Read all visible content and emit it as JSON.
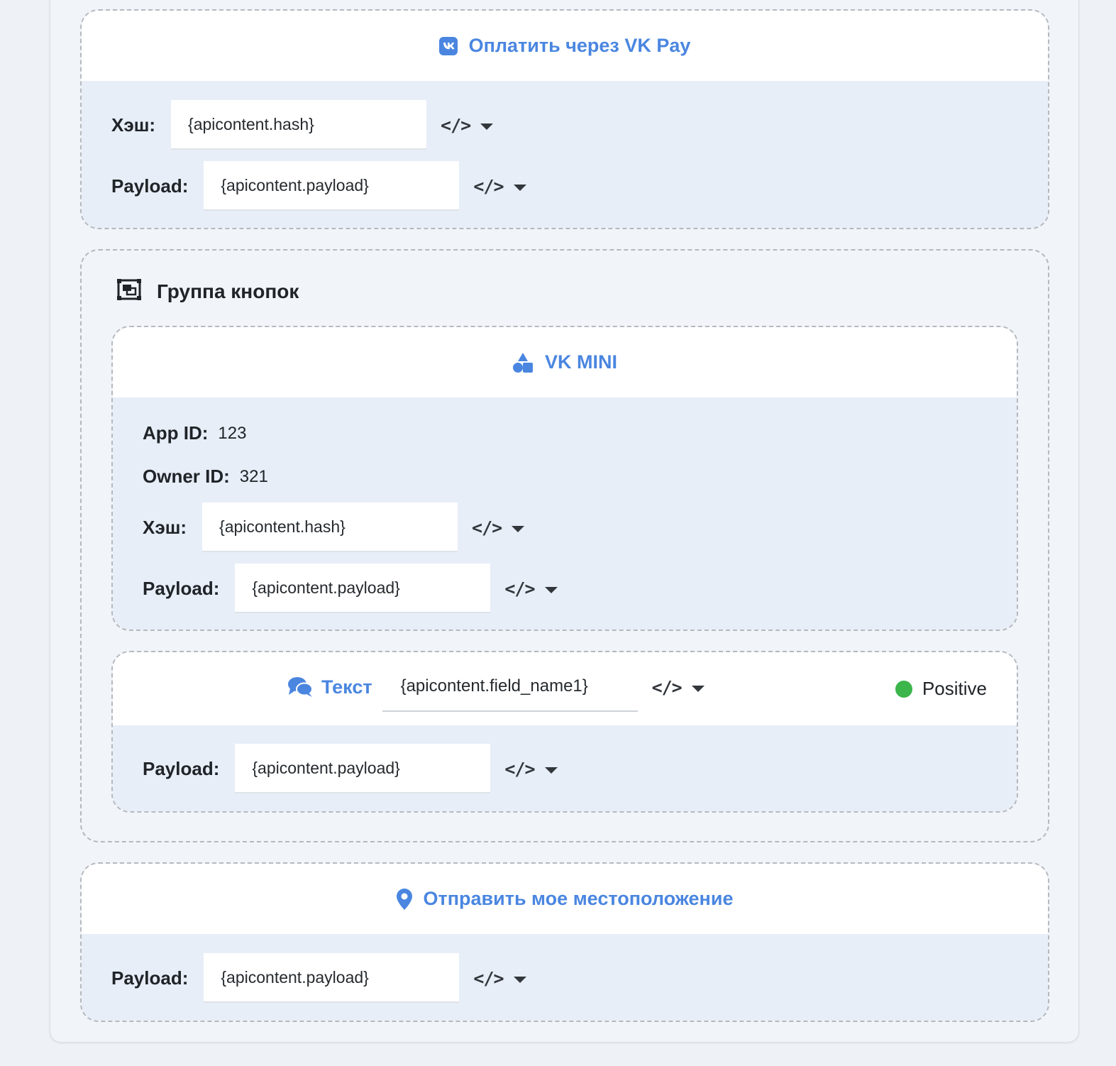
{
  "vkpay": {
    "title": "Оплатить через VK Pay",
    "hash_label": "Хэш:",
    "hash_value": "{apicontent.hash}",
    "payload_label": "Payload:",
    "payload_value": "{apicontent.payload}"
  },
  "group": {
    "title": "Группа кнопок",
    "vkmini": {
      "title": "VK MINI",
      "app_id_label": "App ID:",
      "app_id_value": "123",
      "owner_id_label": "Owner ID:",
      "owner_id_value": "321",
      "hash_label": "Хэш:",
      "hash_value": "{apicontent.hash}",
      "payload_label": "Payload:",
      "payload_value": "{apicontent.payload}"
    },
    "text_button": {
      "title": "Текст",
      "field_value": "{apicontent.field_name1}",
      "color_label": "Positive",
      "color": "#3cb54a",
      "payload_label": "Payload:",
      "payload_value": "{apicontent.payload}"
    }
  },
  "location": {
    "title": "Отправить мое местоположение",
    "payload_label": "Payload:",
    "payload_value": "{apicontent.payload}"
  },
  "icons": {
    "code": "</>",
    "accent": "#4a86e0"
  }
}
